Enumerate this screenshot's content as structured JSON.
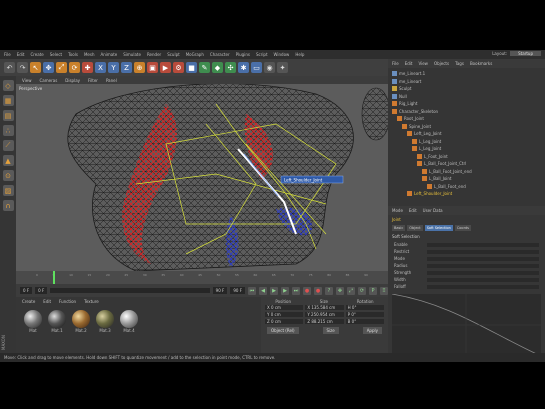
{
  "menubar": {
    "items": [
      "File",
      "Edit",
      "Create",
      "Select",
      "Tools",
      "Mesh",
      "Animate",
      "Simulate",
      "Render",
      "Sculpt",
      "MoGraph",
      "Character",
      "Plugins",
      "Script",
      "Window",
      "Help"
    ],
    "layout_label": "Layout:",
    "layout_value": "Startup"
  },
  "toolbar": {
    "icons": [
      {
        "name": "undo-icon",
        "glyph": "↶",
        "tone": ""
      },
      {
        "name": "redo-icon",
        "glyph": "↷",
        "tone": ""
      },
      {
        "name": "live-selection-icon",
        "glyph": "↖",
        "tone": "o"
      },
      {
        "name": "move-icon",
        "glyph": "✥",
        "tone": "b"
      },
      {
        "name": "scale-icon",
        "glyph": "⤢",
        "tone": "o"
      },
      {
        "name": "rotate-icon",
        "glyph": "⟳",
        "tone": "o"
      },
      {
        "name": "last-tool-icon",
        "glyph": "✚",
        "tone": "r"
      },
      {
        "name": "x-axis-icon",
        "glyph": "X",
        "tone": "b"
      },
      {
        "name": "y-axis-icon",
        "glyph": "Y",
        "tone": "b"
      },
      {
        "name": "z-axis-icon",
        "glyph": "Z",
        "tone": "b"
      },
      {
        "name": "coordinate-system-icon",
        "glyph": "⊕",
        "tone": "o"
      },
      {
        "name": "render-view-icon",
        "glyph": "▣",
        "tone": "r"
      },
      {
        "name": "render-picture-icon",
        "glyph": "▶",
        "tone": "r"
      },
      {
        "name": "render-settings-icon",
        "glyph": "⚙",
        "tone": "r"
      },
      {
        "name": "cube-icon",
        "glyph": "■",
        "tone": "b"
      },
      {
        "name": "pen-icon",
        "glyph": "✎",
        "tone": "g"
      },
      {
        "name": "subdivision-icon",
        "glyph": "◆",
        "tone": "g"
      },
      {
        "name": "array-icon",
        "glyph": "✣",
        "tone": "g"
      },
      {
        "name": "deformer-icon",
        "glyph": "✱",
        "tone": "b"
      },
      {
        "name": "floor-icon",
        "glyph": "▭",
        "tone": "b"
      },
      {
        "name": "camera-icon",
        "glyph": "◉",
        "tone": ""
      },
      {
        "name": "light-icon",
        "glyph": "✦",
        "tone": ""
      }
    ]
  },
  "lefttools": {
    "icons": [
      {
        "name": "make-editable-icon",
        "glyph": "◇"
      },
      {
        "name": "model-mode-icon",
        "glyph": "▦"
      },
      {
        "name": "texture-mode-icon",
        "glyph": "▤"
      },
      {
        "name": "points-mode-icon",
        "glyph": "∴"
      },
      {
        "name": "edges-mode-icon",
        "glyph": "⟋"
      },
      {
        "name": "polygons-mode-icon",
        "glyph": "▲"
      },
      {
        "name": "snap-icon",
        "glyph": "⊙"
      },
      {
        "name": "workplane-icon",
        "glyph": "▨"
      },
      {
        "name": "magnet-icon",
        "glyph": "∩"
      }
    ]
  },
  "viewport": {
    "menu": [
      "View",
      "Cameras",
      "Display",
      "Filter",
      "Panel"
    ],
    "label": "Perspective",
    "bone_tag": "Left_Shoulder_Joint"
  },
  "timeline": {
    "ticks": [
      "0",
      "5",
      "10",
      "15",
      "20",
      "25",
      "30",
      "35",
      "40",
      "45",
      "50",
      "55",
      "60",
      "65",
      "70",
      "75",
      "80",
      "85",
      "90"
    ]
  },
  "playback": {
    "start_frame": "0 F",
    "current_frame": "0 F",
    "end_frame": "90 F",
    "max_frame": "90 F"
  },
  "material_manager": {
    "menu": [
      "Create",
      "Edit",
      "Function",
      "Texture"
    ],
    "materials": [
      "Mat",
      "Mat.1",
      "Mat.2",
      "Mat.3",
      "Mat.4"
    ]
  },
  "coordinates": {
    "headers": [
      "Position",
      "Size",
      "Rotation"
    ],
    "rows": [
      [
        "X  0 cm",
        "X  135.584 cm",
        "H  0°"
      ],
      [
        "Y  0 cm",
        "Y  250.954 cm",
        "P  0°"
      ],
      [
        "Z  0 cm",
        "Z  88.215 cm",
        "B  0°"
      ]
    ],
    "mode_button": "Object (Rel)",
    "size_mode": "Size",
    "apply_button": "Apply"
  },
  "object_manager": {
    "menu": [
      "File",
      "Edit",
      "View",
      "Objects",
      "Tags",
      "Bookmarks"
    ],
    "rows": [
      {
        "indent": 0,
        "label": "me_Lineart.1",
        "icon": "",
        "sel": false
      },
      {
        "indent": 0,
        "label": "me_Lineart",
        "icon": "",
        "sel": false
      },
      {
        "indent": 0,
        "label": "Sculpt",
        "icon": "y",
        "sel": false
      },
      {
        "indent": 0,
        "label": "Null",
        "icon": "",
        "sel": false
      },
      {
        "indent": 0,
        "label": "Rig_Light",
        "icon": "o",
        "sel": false
      },
      {
        "indent": 0,
        "label": "Character_Skeleton",
        "icon": "o",
        "sel": false
      },
      {
        "indent": 1,
        "label": "Root_Joint",
        "icon": "o",
        "sel": false
      },
      {
        "indent": 2,
        "label": "Spine_Joint",
        "icon": "o",
        "sel": false
      },
      {
        "indent": 3,
        "label": "Left_Leg_Joint",
        "icon": "o",
        "sel": false
      },
      {
        "indent": 4,
        "label": "L_Leg_Joint",
        "icon": "o",
        "sel": false
      },
      {
        "indent": 4,
        "label": "L_Leg_Joint",
        "icon": "o",
        "sel": false
      },
      {
        "indent": 5,
        "label": "L_Foot_Joint",
        "icon": "o",
        "sel": false
      },
      {
        "indent": 5,
        "label": "L_Ball_Foot_Joint_Ctrl",
        "icon": "o",
        "sel": false
      },
      {
        "indent": 6,
        "label": "L_Ball_Foot_Joint_end",
        "icon": "o",
        "sel": false
      },
      {
        "indent": 6,
        "label": "L_Ball_Joint",
        "icon": "o",
        "sel": false
      },
      {
        "indent": 7,
        "label": "L_Ball_Foot_end",
        "icon": "o",
        "sel": false
      },
      {
        "indent": 3,
        "label": "Left_Shoulder_Joint",
        "icon": "o",
        "sel": true
      }
    ]
  },
  "attributes": {
    "menu": [
      "Mode",
      "Edit",
      "User Data"
    ],
    "object_name": "Joint",
    "tabs": [
      {
        "label": "Basic",
        "active": false
      },
      {
        "label": "Object",
        "active": false
      },
      {
        "label": "Soft Selection",
        "active": true
      },
      {
        "label": "Coords",
        "active": false
      }
    ],
    "section": "Soft Selection",
    "rows": [
      "Enable",
      "Restrict",
      "Mode",
      "Radius",
      "Strength",
      "Width",
      "Falloff"
    ]
  },
  "status": {
    "text": "Move: Click and drag to move elements. Hold down SHIFT to quantize movement / add to the selection in point mode, CTRL to remove."
  },
  "logo": {
    "text": "MAXON"
  }
}
